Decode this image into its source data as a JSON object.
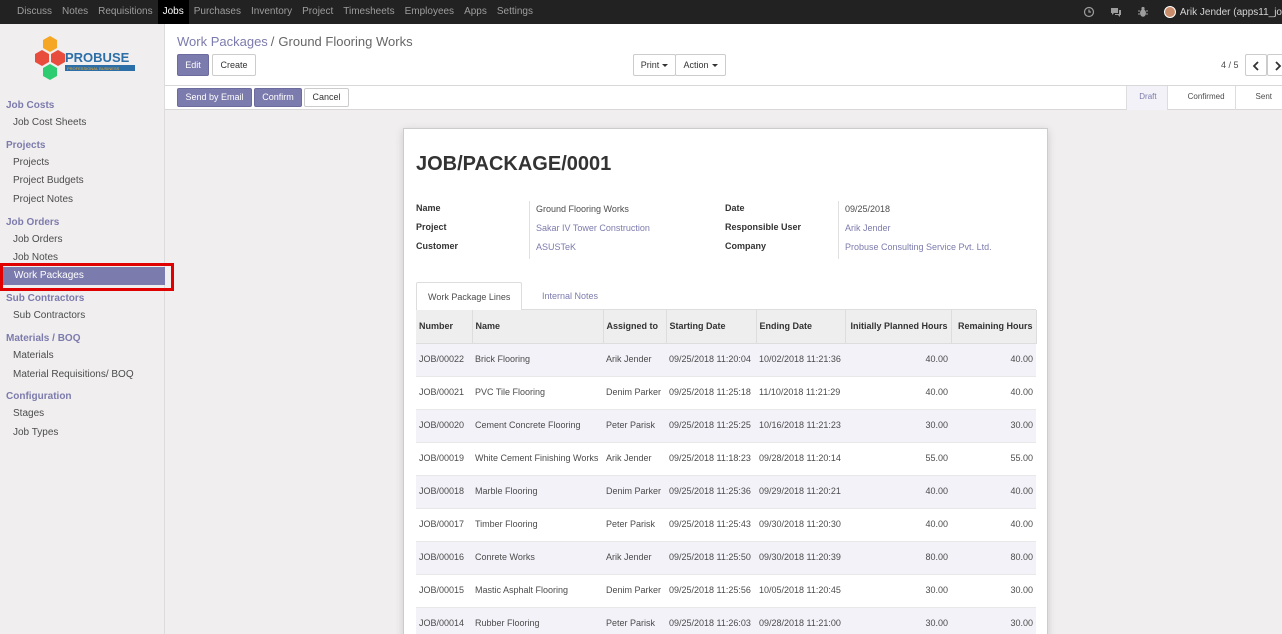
{
  "topbar": {
    "menus": [
      "Discuss",
      "Notes",
      "Requisitions",
      "Jobs",
      "Purchases",
      "Inventory",
      "Project",
      "Timesheets",
      "Employees",
      "Apps",
      "Settings"
    ],
    "active_menu": "Jobs",
    "user_name": "Arik Jender (apps11_jo",
    "icons": [
      "clock-icon",
      "chat-icon",
      "bug-icon"
    ]
  },
  "logo": {
    "brand": "PROBUSE",
    "tagline": "PROFESSIONAL BUSINESS"
  },
  "sidebar": {
    "sections": [
      {
        "title": "Job Costs",
        "items": [
          "Job Cost Sheets"
        ]
      },
      {
        "title": "Projects",
        "items": [
          "Projects",
          "Project Budgets",
          "Project Notes"
        ]
      },
      {
        "title": "Job Orders",
        "items": [
          "Job Orders",
          "Job Notes",
          "Work Packages"
        ]
      },
      {
        "title": "Sub Contractors",
        "items": [
          "Sub Contractors"
        ]
      },
      {
        "title": "Materials / BOQ",
        "items": [
          "Materials",
          "Material Requisitions/ BOQ"
        ]
      },
      {
        "title": "Configuration",
        "items": [
          "Stages",
          "Job Types"
        ]
      }
    ],
    "active_item": "Work Packages"
  },
  "breadcrumb": {
    "parent": "Work Packages",
    "separator": "/",
    "current": "Ground Flooring Works"
  },
  "buttons": {
    "edit": "Edit",
    "create": "Create",
    "print": "Print",
    "action": "Action",
    "send_email": "Send by Email",
    "confirm": "Confirm",
    "cancel": "Cancel"
  },
  "pager": {
    "value": "4 / 5"
  },
  "status": {
    "steps": [
      "Draft",
      "Confirmed",
      "Sent"
    ],
    "current": "Draft"
  },
  "record": {
    "title": "JOB/PACKAGE/0001",
    "labels": {
      "name": "Name",
      "project": "Project",
      "customer": "Customer",
      "date": "Date",
      "responsible": "Responsible User",
      "company": "Company"
    },
    "name": "Ground Flooring Works",
    "project": "Sakar IV Tower Construction",
    "customer": "ASUSTeK",
    "date": "09/25/2018",
    "responsible": "Arik Jender",
    "company": "Probuse Consulting Service Pvt. Ltd."
  },
  "tabs": [
    "Work Package Lines",
    "Internal Notes"
  ],
  "lines": {
    "headers": [
      "Number",
      "Name",
      "Assigned to",
      "Starting Date",
      "Ending Date",
      "Initially Planned Hours",
      "Remaining Hours"
    ],
    "rows": [
      [
        "JOB/00022",
        "Brick Flooring",
        "Arik Jender",
        "09/25/2018 11:20:04",
        "10/02/2018 11:21:36",
        "40.00",
        "40.00"
      ],
      [
        "JOB/00021",
        "PVC Tile Flooring",
        "Denim Parker",
        "09/25/2018 11:25:18",
        "11/10/2018 11:21:29",
        "40.00",
        "40.00"
      ],
      [
        "JOB/00020",
        "Cement Concrete Flooring",
        "Peter Parisk",
        "09/25/2018 11:25:25",
        "10/16/2018 11:21:23",
        "30.00",
        "30.00"
      ],
      [
        "JOB/00019",
        "White Cement Finishing Works",
        "Arik Jender",
        "09/25/2018 11:18:23",
        "09/28/2018 11:20:14",
        "55.00",
        "55.00"
      ],
      [
        "JOB/00018",
        "Marble Flooring",
        "Denim Parker",
        "09/25/2018 11:25:36",
        "09/29/2018 11:20:21",
        "40.00",
        "40.00"
      ],
      [
        "JOB/00017",
        "Timber Flooring",
        "Peter Parisk",
        "09/25/2018 11:25:43",
        "09/30/2018 11:20:30",
        "40.00",
        "40.00"
      ],
      [
        "JOB/00016",
        "Conrete Works",
        "Arik Jender",
        "09/25/2018 11:25:50",
        "09/30/2018 11:20:39",
        "80.00",
        "80.00"
      ],
      [
        "JOB/00015",
        "Mastic Asphalt Flooring",
        "Denim Parker",
        "09/25/2018 11:25:56",
        "10/05/2018 11:20:45",
        "30.00",
        "30.00"
      ],
      [
        "JOB/00014",
        "Rubber Flooring",
        "Peter Parisk",
        "09/25/2018 11:26:03",
        "09/28/2018 11:21:00",
        "30.00",
        "30.00"
      ]
    ]
  },
  "colors": {
    "accent": "#7c7bad",
    "topbar": "#222222",
    "highlight": "#e00000"
  }
}
